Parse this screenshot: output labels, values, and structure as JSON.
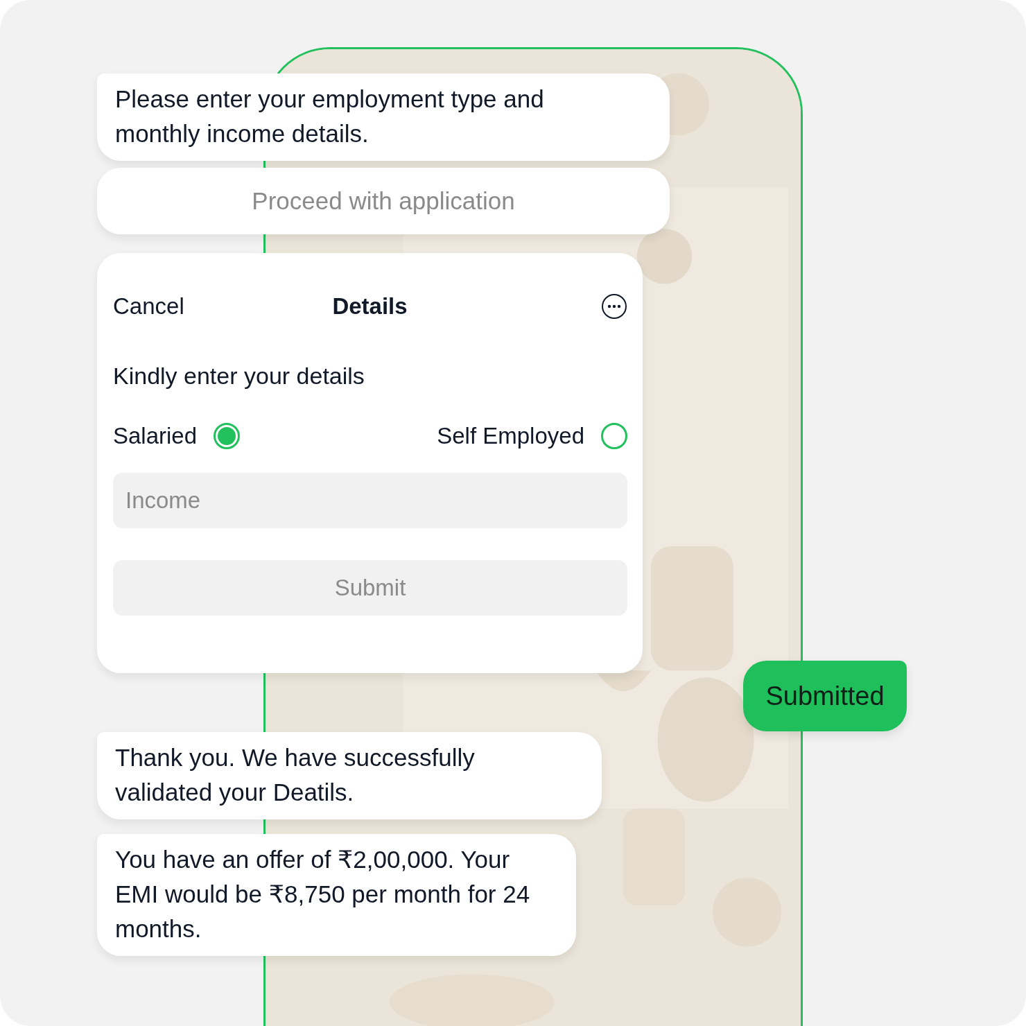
{
  "messages_before": [
    {
      "kind": "text",
      "text": "Please enter your employment type and monthly income details."
    },
    {
      "kind": "button",
      "label": "Proceed with application"
    }
  ],
  "form": {
    "cancel": "Cancel",
    "title": "Details",
    "prompt": "Kindly enter your details",
    "options": [
      {
        "label": "Salaried",
        "selected": true
      },
      {
        "label": "Self Employed",
        "selected": false
      }
    ],
    "income": {
      "placeholder": "Income"
    },
    "submit": {
      "label": "Submit",
      "disabled": true
    }
  },
  "reply": {
    "text": "Submitted"
  },
  "messages_after": [
    {
      "kind": "text",
      "text": "Thank you. We have successfully validated your Deatils."
    },
    {
      "kind": "text",
      "text": "You have an offer of ₹2,00,000. Your EMI would be ₹8,750 per month for 24 months."
    }
  ]
}
